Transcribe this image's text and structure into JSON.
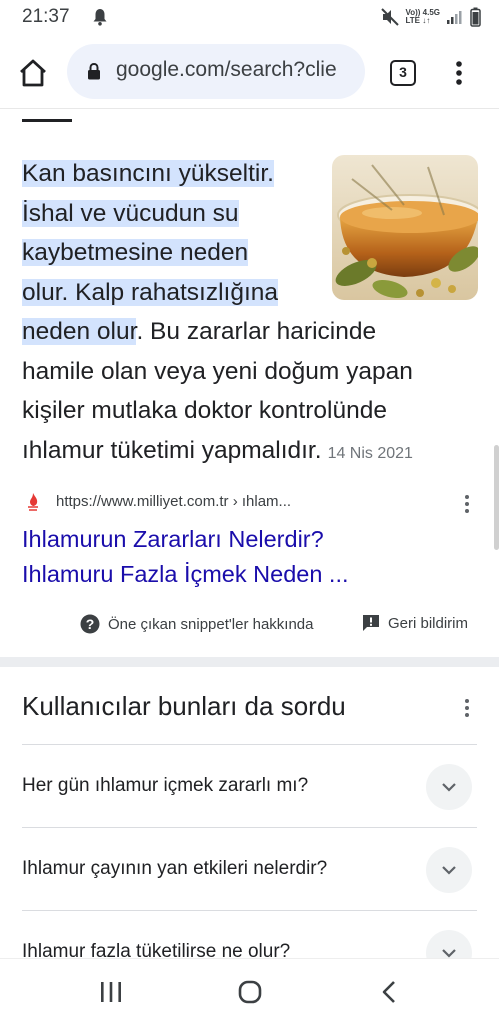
{
  "status_bar": {
    "time": "21:37",
    "network_top": "Vo)) 4.5G",
    "network_bottom": "LTE ↓↑",
    "icons": [
      "bell-icon",
      "mute-icon",
      "signal-icon",
      "battery-icon"
    ]
  },
  "browser": {
    "url": "google.com/search?clie",
    "tab_count": "3",
    "icons": [
      "home-icon",
      "lock-icon",
      "more-vert-icon"
    ]
  },
  "snippet": {
    "highlight_lines": [
      "Kan basıncını yükseltir.",
      "İshal ve vücudun su",
      "kaybetmesine neden",
      "olur. Kalp rahatsızlığına"
    ],
    "line5_highlight": "neden olur",
    "line5_rest": ". Bu zararlar haricinde",
    "line6": "hamile olan veya yeni doğum yapan",
    "line7": "kişiler mutlaka doktor kontrolünde",
    "line8": "ıhlamur tüketimi yapmalıdır.",
    "date": "14 Nis 2021",
    "image_alt": "linden tea in a glass cup with dried linden flowers"
  },
  "source": {
    "url": "https://www.milliyet.com.tr › ıhlam...",
    "title_line1": "Ihlamurun Zararları Nelerdir?",
    "title_line2": "Ihlamuru Fazla İçmek Neden ..."
  },
  "snippet_footer": {
    "about_label": "Öne çıkan snippet'ler hakkında",
    "feedback_label": "Geri bildirim"
  },
  "people_also_ask": {
    "heading": "Kullanıcılar bunları da sordu",
    "questions": [
      "Her gün ıhlamur içmek zararlı mı?",
      "Ihlamur çayının yan etkileri nelerdir?",
      "Ihlamur fazla tüketilirse ne olur?"
    ]
  },
  "nav_bar": {
    "icons": [
      "recents-icon",
      "home-circle-icon",
      "back-icon"
    ]
  },
  "colors": {
    "highlight": "#d3e3fd",
    "link": "#1a0dab",
    "url_pill": "#eef2fb"
  }
}
